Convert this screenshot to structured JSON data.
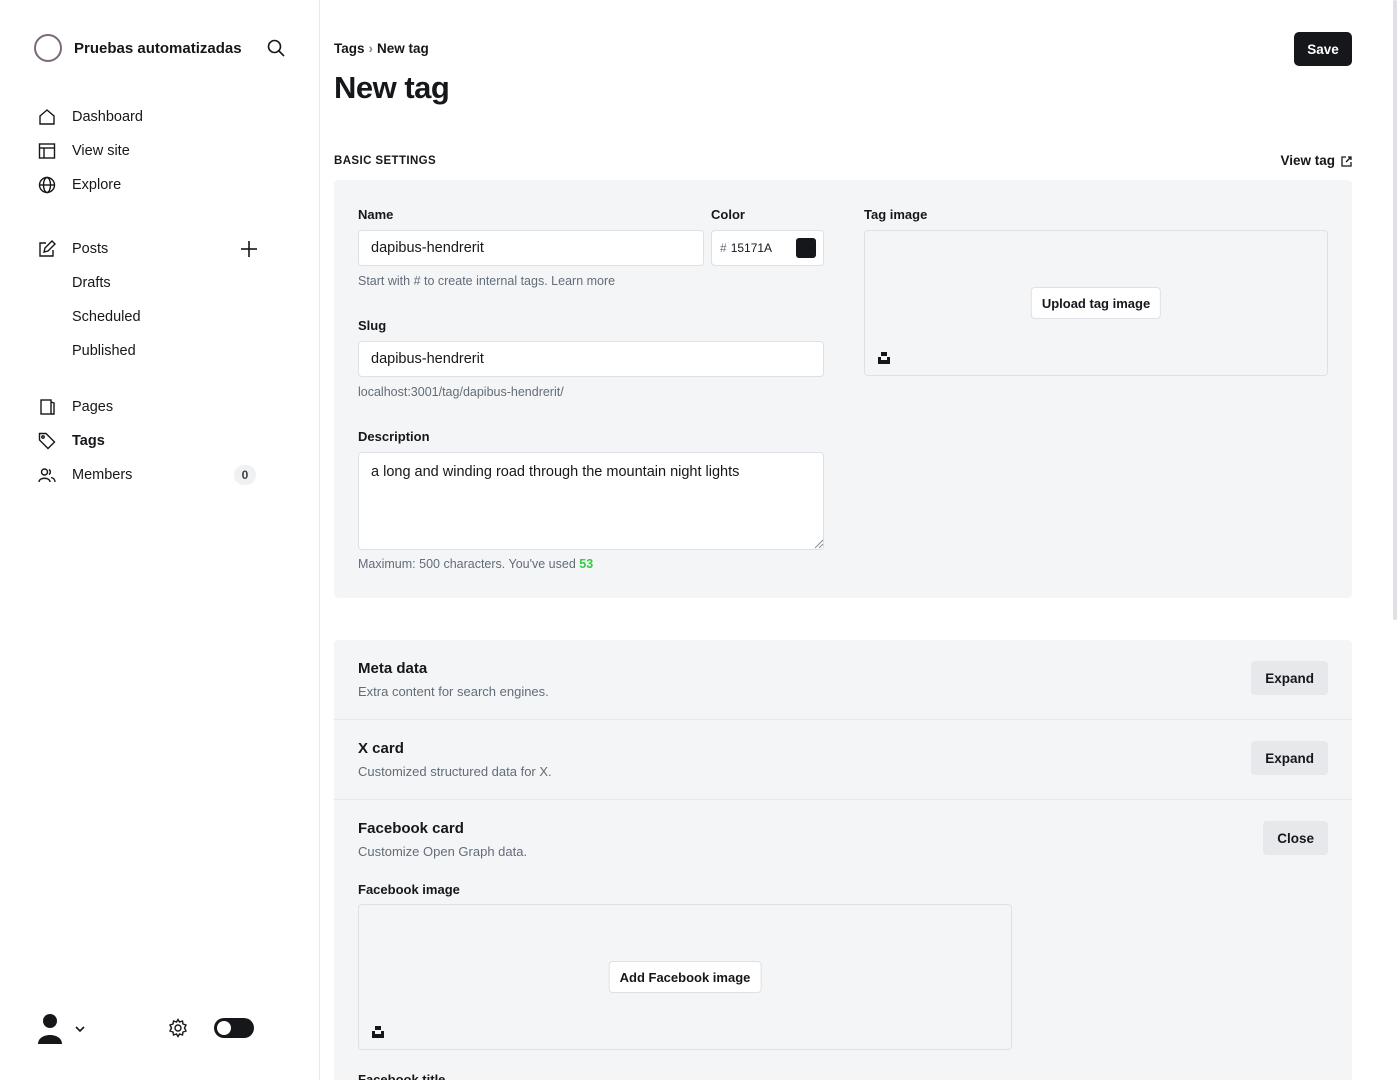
{
  "sidebar": {
    "site_title": "Pruebas automatizadas",
    "nav": {
      "dashboard": "Dashboard",
      "view_site": "View site",
      "explore": "Explore",
      "posts": "Posts",
      "drafts": "Drafts",
      "scheduled": "Scheduled",
      "published": "Published",
      "pages": "Pages",
      "tags": "Tags",
      "members": "Members",
      "members_count": "0"
    },
    "icons": [
      "search-icon",
      "home-icon",
      "layout-icon",
      "globe-icon",
      "edit-icon",
      "plus-icon",
      "page-icon",
      "tag-icon",
      "users-icon",
      "user-avatar-icon",
      "chevron-down-icon",
      "gear-icon",
      "theme-toggle"
    ]
  },
  "header": {
    "breadcrumb_parent": "Tags",
    "breadcrumb_current": "New tag",
    "title": "New tag",
    "save_label": "Save"
  },
  "basic": {
    "section_label": "BASIC SETTINGS",
    "view_tag": "View tag",
    "name_label": "Name",
    "name_value": "dapibus-hendrerit",
    "name_hint": "Start with # to create internal tags.",
    "name_hint_link": "Learn more",
    "color_label": "Color",
    "color_hash": "#",
    "color_value": "15171A",
    "tag_image_label": "Tag image",
    "upload_label": "Upload tag image",
    "slug_label": "Slug",
    "slug_value": "dapibus-hendrerit",
    "slug_url": "localhost:3001/tag/dapibus-hendrerit/",
    "description_label": "Description",
    "description_value": "a long and winding road through the mountain night lights",
    "description_hint": "Maximum: 500 characters. You've used",
    "description_count": "53"
  },
  "meta": {
    "title": "Meta data",
    "desc": "Extra content for search engines.",
    "button": "Expand"
  },
  "xcard": {
    "title": "X card",
    "desc": "Customized structured data for X.",
    "button": "Expand"
  },
  "facebook": {
    "title": "Facebook card",
    "desc": "Customize Open Graph data.",
    "button": "Close",
    "image_label": "Facebook image",
    "add_image": "Add Facebook image",
    "sub_label": "Facebook title"
  },
  "colors": {
    "accent": "#15171a",
    "panel": "#f4f5f6",
    "success": "#30cf43"
  }
}
